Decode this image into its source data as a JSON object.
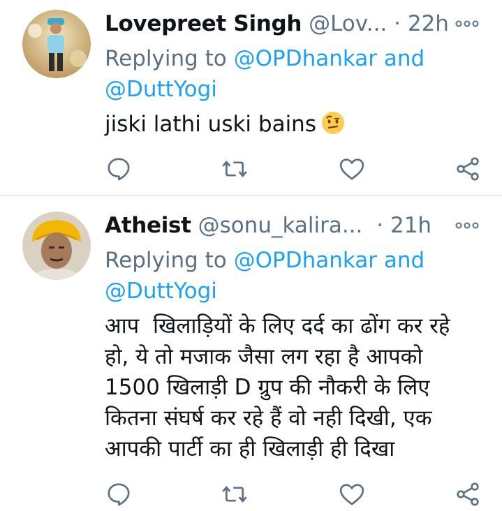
{
  "tweets": [
    {
      "name": "Lovepreet Singh",
      "handle": "@Lov...",
      "time": "· 22h",
      "replying_prefix": "Replying to",
      "mention1": "@OPDhankar",
      "and": "and",
      "mention2": "@DuttYogi",
      "text": "jiski lathi uski bains",
      "emoji": "face-with-raised-eyebrow-emoji"
    },
    {
      "name": "Atheist",
      "handle": "@sonu_kalira...",
      "time": "· 21h",
      "replying_prefix": "Replying to",
      "mention1": "@OPDhankar",
      "and": "and",
      "mention2": "@DuttYogi",
      "text_lines": [
        "आप  खिलाड़ियों के लिए दर्द का ढोंग कर रहे",
        "हो, ये तो मजाक जैसा लग रहा है आपको",
        "1500 खिलाड़ी D ग्रुप की नौकरी के लिए",
        "कितना संघर्ष कर रहे हैं वो नही दिखी, एक",
        "आपकी पार्टी का ही खिलाड़ी ही दिखा"
      ]
    }
  ],
  "icons": {
    "reply": "reply-icon",
    "retweet": "retweet-icon",
    "like": "heart-icon",
    "share": "share-icon",
    "more": "more-icon"
  },
  "colors": {
    "link": "#1da1f2",
    "secondary": "#5b7083",
    "divider": "#e6ecf0"
  }
}
